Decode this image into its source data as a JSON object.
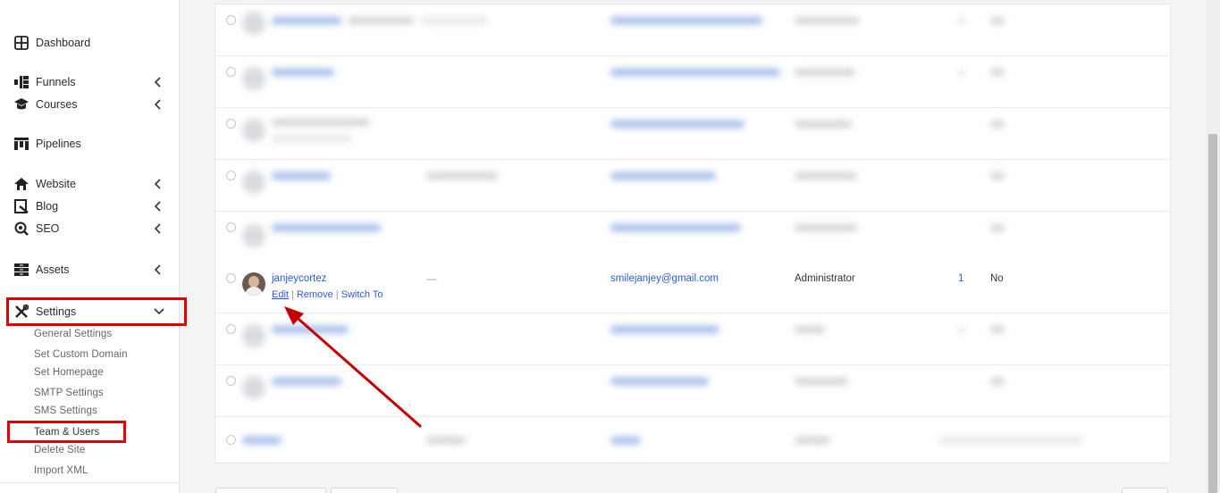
{
  "sidebar": {
    "items": [
      {
        "label": "Dashboard",
        "icon": "dashboard-icon",
        "has_chevron": false
      },
      {
        "label": "Funnels",
        "icon": "funnels-icon",
        "has_chevron": true
      },
      {
        "label": "Courses",
        "icon": "courses-icon",
        "has_chevron": true
      },
      {
        "label": "Pipelines",
        "icon": "pipelines-icon",
        "has_chevron": false
      },
      {
        "label": "Website",
        "icon": "home-icon",
        "has_chevron": true
      },
      {
        "label": "Blog",
        "icon": "blog-icon",
        "has_chevron": true
      },
      {
        "label": "SEO",
        "icon": "seo-icon",
        "has_chevron": true
      },
      {
        "label": "Assets",
        "icon": "assets-icon",
        "has_chevron": true
      },
      {
        "label": "Settings",
        "icon": "tools-icon",
        "has_chevron": true,
        "expanded": true
      }
    ],
    "settings_sub": [
      "General Settings",
      "Set Custom Domain",
      "Set Homepage",
      "SMTP Settings",
      "SMS Settings",
      "Team & Users",
      "Delete Site",
      "Import XML"
    ]
  },
  "table": {
    "focus_user": {
      "username": "janjeycortez",
      "actions": {
        "edit": "Edit",
        "remove": "Remove",
        "switch_to": "Switch To"
      },
      "name": "—",
      "email": "smilejanjey@gmail.com",
      "role": "Administrator",
      "posts": "1",
      "two_factor": "No"
    }
  },
  "colors": {
    "highlight_red": "#e40000",
    "link_blue": "#2a5bd7",
    "arrow_red": "#c40000"
  }
}
